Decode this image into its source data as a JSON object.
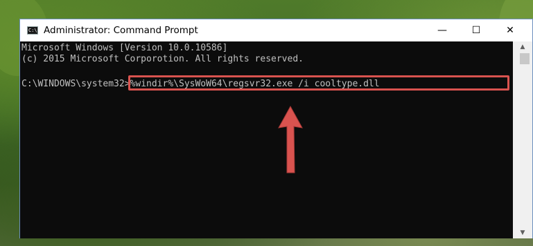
{
  "window": {
    "title": "Administrator: Command Prompt",
    "icon": "cmd-icon",
    "icon_text": "C:\\",
    "controls": {
      "minimize": "—",
      "maximize": "☐",
      "close": "✕"
    }
  },
  "console": {
    "lines": [
      "Microsoft Windows [Version 10.0.10586]",
      "(c) 2015 Microsoft Corporotion. All rights reserved.",
      "",
      "C:\\WINDOWS\\system32>%windir%\\SysWoW64\\regsvr32.exe /i cooltype.dll"
    ],
    "prompt": "C:\\WINDOWS\\system32>",
    "command": "%windir%\\SysWoW64\\regsvr32.exe /i cooltype.dll"
  },
  "scrollbar": {
    "up_arrow": "▲",
    "down_arrow": "▼"
  },
  "annotation": {
    "highlight_color": "#d9534f",
    "arrow_color": "#d9534f",
    "arrow_icon": "up-arrow-annotation"
  }
}
